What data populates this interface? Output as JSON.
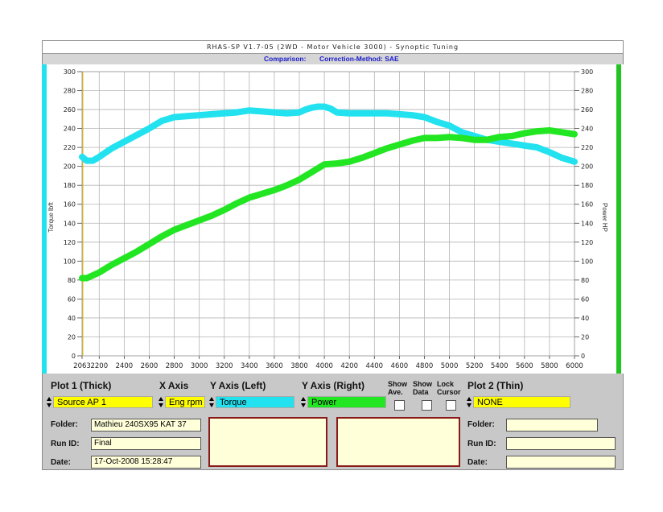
{
  "window": {
    "title": "RHAS-SP V1.7-05   (2WD - Motor Vehicle 3000) - Synoptic Tuning",
    "comparison_label": "Comparison:",
    "correction_label": "Correction-Method: SAE"
  },
  "colors": {
    "torque": "#22e2f0",
    "power": "#22e622",
    "field_yellow": "#ffff00",
    "info_bg": "#ffffd9",
    "left_strip": "#22e2f0",
    "right_strip": "#22c322"
  },
  "chart_data": {
    "type": "line",
    "title": "",
    "xlabel": "",
    "ylabel_left": "Torque lbft",
    "ylabel_right": "Power HP",
    "xlim": [
      2063,
      6000
    ],
    "ylim": [
      0,
      300
    ],
    "x_ticks": [
      "2063",
      "2200",
      "2400",
      "2600",
      "2800",
      "3000",
      "3200",
      "3400",
      "3600",
      "3800",
      "4000",
      "4200",
      "4400",
      "4600",
      "4800",
      "5000",
      "5200",
      "5400",
      "5600",
      "5800",
      "6000"
    ],
    "y_ticks": [
      0,
      20,
      40,
      60,
      80,
      100,
      120,
      140,
      160,
      180,
      200,
      220,
      240,
      260,
      280,
      300
    ],
    "grid": true,
    "series": [
      {
        "name": "Torque",
        "axis": "left",
        "x": [
          2063,
          2100,
          2150,
          2200,
          2300,
          2400,
          2500,
          2600,
          2700,
          2800,
          2900,
          3000,
          3100,
          3200,
          3300,
          3400,
          3500,
          3600,
          3700,
          3800,
          3850,
          3900,
          3950,
          4000,
          4050,
          4100,
          4200,
          4300,
          4400,
          4500,
          4600,
          4700,
          4800,
          4900,
          5000,
          5100,
          5200,
          5300,
          5400,
          5500,
          5600,
          5700,
          5800,
          5900,
          6000
        ],
        "y": [
          210,
          206,
          206,
          210,
          219,
          226,
          233,
          240,
          248,
          252,
          253,
          254,
          255,
          256,
          257,
          259,
          258,
          257,
          256,
          257,
          260,
          262,
          263,
          263,
          261,
          257,
          256,
          256,
          256,
          256,
          255,
          254,
          252,
          247,
          243,
          236,
          232,
          228,
          226,
          224,
          222,
          220,
          215,
          209,
          205
        ]
      },
      {
        "name": "Power",
        "axis": "right",
        "x": [
          2063,
          2100,
          2200,
          2300,
          2400,
          2500,
          2600,
          2700,
          2800,
          2900,
          3000,
          3100,
          3200,
          3300,
          3400,
          3500,
          3600,
          3700,
          3800,
          3900,
          4000,
          4100,
          4200,
          4300,
          4400,
          4500,
          4600,
          4700,
          4800,
          4900,
          5000,
          5100,
          5200,
          5300,
          5400,
          5500,
          5600,
          5700,
          5800,
          5900,
          6000
        ],
        "y": [
          82,
          82,
          88,
          96,
          103,
          110,
          118,
          126,
          133,
          138,
          143,
          148,
          154,
          161,
          167,
          171,
          175,
          180,
          186,
          194,
          202,
          203,
          205,
          209,
          214,
          219,
          223,
          227,
          230,
          230,
          231,
          230,
          228,
          228,
          231,
          232,
          235,
          237,
          238,
          236,
          234
        ]
      }
    ]
  },
  "panel": {
    "plot1": {
      "header": "Plot 1 (Thick)",
      "value": "Source AP 1"
    },
    "xaxis": {
      "header": "X Axis",
      "value": "Eng rpm"
    },
    "yleft": {
      "header": "Y Axis (Left)",
      "value": "Torque"
    },
    "yright": {
      "header": "Y Axis (Right)",
      "value": "Power"
    },
    "show_ave": {
      "line1": "Show",
      "line2": "Ave."
    },
    "show_data": {
      "line1": "Show",
      "line2": "Data"
    },
    "lock_cursor": {
      "line1": "Lock",
      "line2": "Cursor"
    },
    "plot2": {
      "header": "Plot 2 (Thin)",
      "value": "NONE"
    },
    "left_info": {
      "folder_label": "Folder:",
      "folder_value": "Mathieu 240SX95 KAT 37",
      "runid_label": "Run ID:",
      "runid_value": "Final",
      "date_label": "Date:",
      "date_value": "17-Oct-2008  15:28:47"
    },
    "right_info": {
      "folder_label": "Folder:",
      "folder_value": "",
      "runid_label": "Run ID:",
      "runid_value": "",
      "date_label": "Date:",
      "date_value": ""
    }
  }
}
